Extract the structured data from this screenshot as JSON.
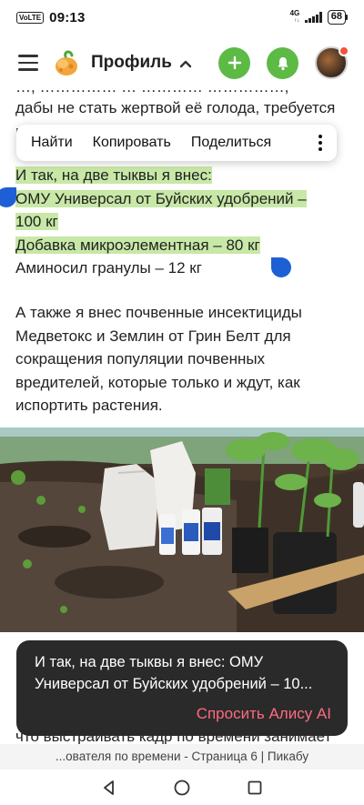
{
  "status_bar": {
    "volte": "VoLTE",
    "time": "09:13",
    "network": "4G",
    "network_sub": "↑↓",
    "battery": "68"
  },
  "header": {
    "title": "Профиль",
    "icons": [
      "menu-icon",
      "logo",
      "chevron-up-icon",
      "plus-icon",
      "bell-icon",
      "avatar"
    ]
  },
  "article": {
    "top_line_1": "…, …………… … ………… ……………,",
    "top_line_2": "дабы не стать жертвой её голода, требуется",
    "top_line_3": "г",
    "selected_lines": [
      "И так, на две тыквы я внес:",
      "ОМУ Универсал от Буйских удобрений –",
      "100 кг",
      "Добавка микроэлементная – 80 кг"
    ],
    "line_after": "Аминосил гранулы – 12 кг",
    "paragraph2": [
      "А также я внес почвенные инсектициды",
      "Медветокс и Землин от Грин Белт для",
      "сокращения популяции почвенных",
      "вредителей, которые только и ждут, как",
      "испортить растения."
    ],
    "bottom_line": "что выстраивать кадр по времени занимает"
  },
  "context_menu": {
    "find": "Найти",
    "copy": "Копировать",
    "share": "Поделиться"
  },
  "alice": {
    "text_line_1": "И так, на две тыквы я внес: ОМУ",
    "text_line_2": "Универсал от Буйских удобрений – 10...",
    "button": "Спросить Алису AI"
  },
  "page_title": "...ователя по времени - Страница 6 | Пикабу",
  "colors": {
    "accent_green": "#5dba45",
    "highlight": "#c7e8a6",
    "selection_handle": "#1e5fd6",
    "alice_button": "#ff6a7e",
    "popup_bg": "#2a2a2a"
  }
}
